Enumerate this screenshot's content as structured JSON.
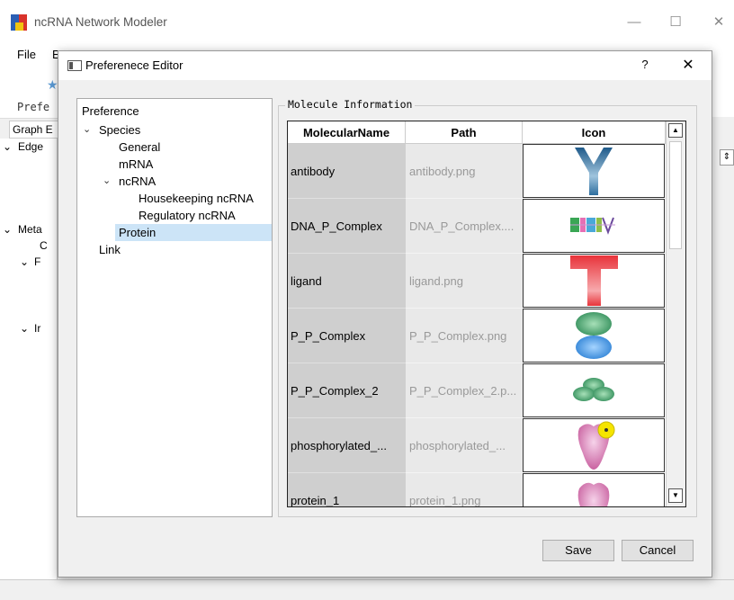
{
  "main_window": {
    "title": "ncRNA Network Modeler",
    "menu": [
      "File",
      "E"
    ],
    "toolbar_label": "Prefe",
    "graph_tab": "Graph E",
    "left_panel_items": [
      "Edge",
      "Meta",
      "C",
      "F",
      "Ir"
    ]
  },
  "dialog": {
    "title": "Preferenece Editor",
    "help_label": "?",
    "close_label": "✕",
    "tree": {
      "root": "Preference",
      "species": "Species",
      "general": "General",
      "mrna": "mRNA",
      "ncrna": "ncRNA",
      "housekeeping": "Housekeeping ncRNA",
      "regulatory": "Regulatory ncRNA",
      "protein": "Protein",
      "link": "Link"
    },
    "group_title": "Molecule Information",
    "table": {
      "headers": [
        "MolecularName",
        "Path",
        "Icon"
      ],
      "rows": [
        {
          "name": "antibody",
          "path": "antibody.png",
          "icon": "antibody-icon"
        },
        {
          "name": "DNA_P_Complex",
          "path": "DNA_P_Complex....",
          "icon": "dna-protein-complex-icon"
        },
        {
          "name": "ligand",
          "path": "ligand.png",
          "icon": "ligand-icon"
        },
        {
          "name": "P_P_Complex",
          "path": "P_P_Complex.png",
          "icon": "protein-protein-complex-icon"
        },
        {
          "name": "P_P_Complex_2",
          "path": "P_P_Complex_2.p...",
          "icon": "protein-complex-2-icon"
        },
        {
          "name": "phosphorylated_...",
          "path": "phosphorylated_...",
          "icon": "phosphorylated-protein-icon"
        },
        {
          "name": "protein_1",
          "path": "protein_1.png",
          "icon": "protein-1-icon"
        }
      ]
    },
    "buttons": {
      "save": "Save",
      "cancel": "Cancel"
    }
  },
  "colors": {
    "selection": "#cce4f7",
    "name_column": "#cfcfcf",
    "path_column": "#e9e9e9",
    "antibody_blue": "#2f6f9f",
    "ligand_red": "#e8333a",
    "complex_green": "#2e8b57",
    "complex_blue": "#2a7fd4",
    "protein_pink": "#d46aa8",
    "phospho_yellow": "#f5e400"
  }
}
